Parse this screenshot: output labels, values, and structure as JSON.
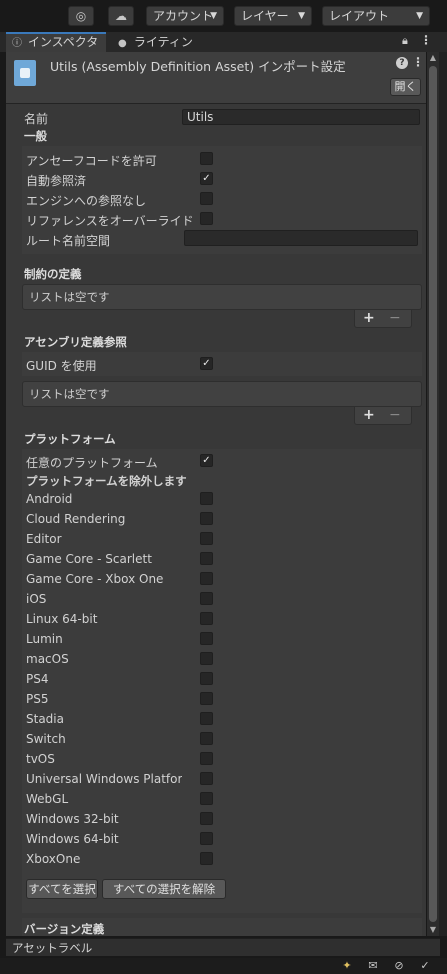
{
  "toolbar": {
    "account_label": "アカウント",
    "layers_label": "レイヤー",
    "layout_label": "レイアウト"
  },
  "tabs": {
    "inspector": "インスペクター",
    "lighting": "ライティング"
  },
  "header": {
    "title": "Utils (Assembly Definition Asset) インポート設定",
    "open_button": "開く"
  },
  "name_row": {
    "label": "名前",
    "value": "Utils"
  },
  "general": {
    "title": "一般",
    "allow_unsafe": {
      "label": "アンセーフコードを許可",
      "checked": false
    },
    "auto_referenced": {
      "label": "自動参照済",
      "checked": true
    },
    "no_engine_refs": {
      "label": "エンジンへの参照なし",
      "checked": false
    },
    "override_refs": {
      "label": "リファレンスをオーバーライド",
      "checked": false
    },
    "root_namespace": {
      "label": "ルート名前空間",
      "value": ""
    }
  },
  "constraints": {
    "title": "制約の定義",
    "empty": "リストは空です"
  },
  "assembly_refs": {
    "title": "アセンブリ定義参照",
    "use_guid": {
      "label": "GUID を使用",
      "checked": true
    },
    "empty": "リストは空です"
  },
  "platforms": {
    "title": "プラットフォーム",
    "any_platform": {
      "label": "任意のプラットフォーム",
      "checked": true
    },
    "exclude_title": "プラットフォームを除外します",
    "items": [
      "Android",
      "Cloud Rendering",
      "Editor",
      "Game Core - Scarlett",
      "Game Core - Xbox One",
      "iOS",
      "Linux 64-bit",
      "Lumin",
      "macOS",
      "PS4",
      "PS5",
      "Stadia",
      "Switch",
      "tvOS",
      "Universal Windows Platform",
      "WebGL",
      "Windows 32-bit",
      "Windows 64-bit",
      "XboxOne"
    ],
    "select_all": "すべてを選択",
    "deselect_all": "すべての選択を解除"
  },
  "version_defines": {
    "title": "バージョン定義"
  },
  "asset_labels": "アセットラベル",
  "colors": {
    "panel": "#383838",
    "accent": "#3a79bb",
    "asset_icon": "#6fa8d8"
  }
}
